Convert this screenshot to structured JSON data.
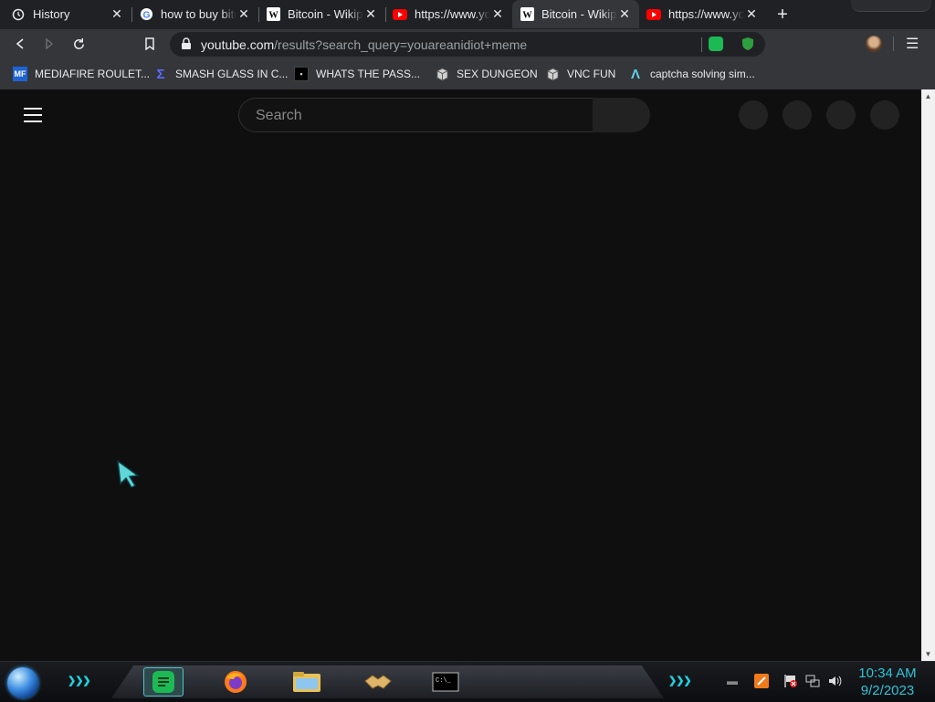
{
  "tabs": [
    {
      "title": "History",
      "icon": "history-icon",
      "active": false
    },
    {
      "title": "how to buy bitcoin",
      "icon": "google-icon",
      "active": false
    },
    {
      "title": "Bitcoin - Wikipedia",
      "icon": "wikipedia-icon",
      "active": false
    },
    {
      "title": "https://www.youtube.com",
      "icon": "youtube-icon",
      "active": false
    },
    {
      "title": "Bitcoin - Wikipedia",
      "icon": "wikipedia-icon",
      "active": true
    },
    {
      "title": "https://www.youtube.com",
      "icon": "youtube-icon",
      "active": false
    }
  ],
  "address_bar": {
    "host": "youtube.com",
    "path": "/results?search_query=youareanidiot+meme"
  },
  "bookmarks": [
    {
      "label": "MEDIAFIRE ROULET...",
      "icon": "mf-icon"
    },
    {
      "label": "SMASH GLASS IN C...",
      "icon": "sigma-icon"
    },
    {
      "label": "WHATS THE PASS...",
      "icon": "lock-icon"
    },
    {
      "label": "SEX DUNGEON",
      "icon": "cube-icon"
    },
    {
      "label": "VNC FUN",
      "icon": "cube-icon"
    },
    {
      "label": "captcha solving sim...",
      "icon": "lambda-icon"
    }
  ],
  "youtube": {
    "search_placeholder": "Search"
  },
  "taskbar": {
    "apps": [
      "spotify-icon",
      "firefox-icon",
      "file-explorer-icon",
      "handshake-icon",
      "terminal-icon"
    ],
    "clock_time": "10:34 AM",
    "clock_date": "9/2/2023"
  },
  "colors": {
    "page_bg": "#0f0f0f",
    "tabstrip_bg": "#202124",
    "toolbar_bg": "#35363a",
    "clock": "#2ec4d6"
  }
}
